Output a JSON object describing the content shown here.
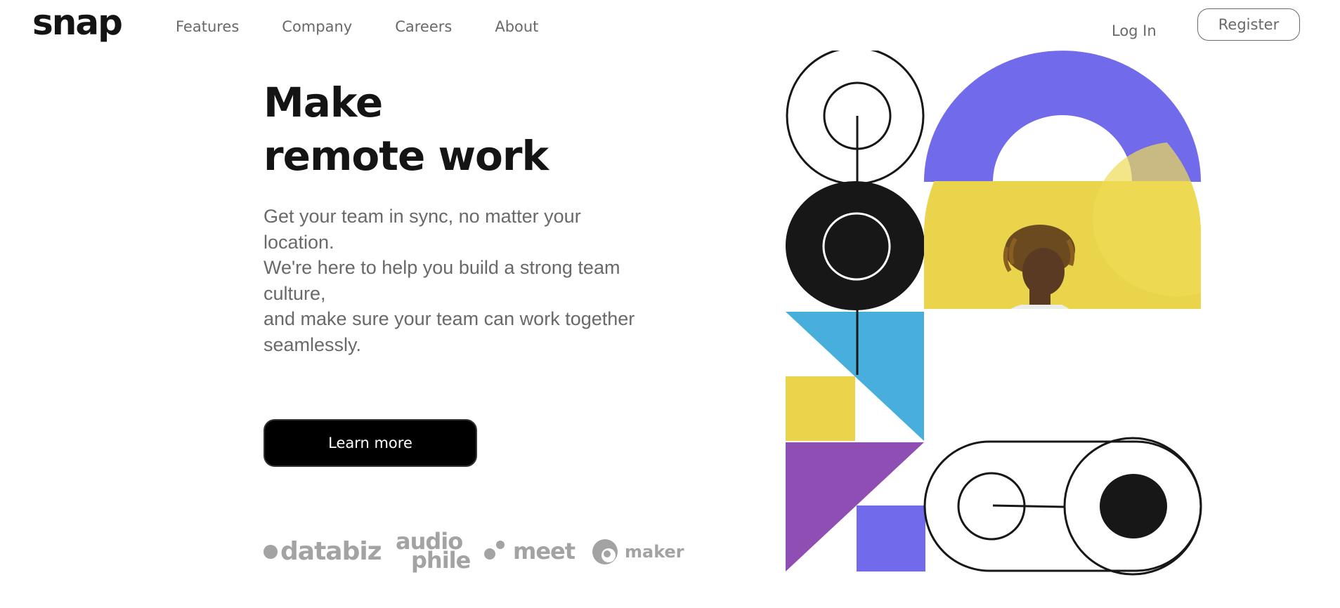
{
  "brand": {
    "logo": "snap"
  },
  "nav": {
    "items": [
      {
        "label": "Features"
      },
      {
        "label": "Company"
      },
      {
        "label": "Careers"
      },
      {
        "label": "About"
      }
    ],
    "login_label": "Log In",
    "register_label": "Register"
  },
  "hero": {
    "headline_line1": "Make",
    "headline_line2": "remote work",
    "description_lines": [
      "Get your team in sync, no matter your",
      "location.",
      "We're here to help you build a strong team",
      "culture,",
      "and make sure your team can work together",
      "seamlessly."
    ],
    "cta_label": "Learn more"
  },
  "clients": {
    "logos": [
      {
        "name": "databiz",
        "icon": "dot-icon"
      },
      {
        "name_line1": "audio",
        "name_line2": "phile"
      },
      {
        "name": "meet",
        "icon": "two-dots-icon"
      },
      {
        "name": "maker",
        "icon": "circle-icon"
      }
    ]
  },
  "colors": {
    "text_dark": "#141414",
    "text_gray": "#696969",
    "logo_gray": "#a3a3a3",
    "purple": "#716beb",
    "yellow": "#e9d44b",
    "blue": "#48aedb",
    "violet": "#8e4eb4",
    "black": "#171717"
  }
}
